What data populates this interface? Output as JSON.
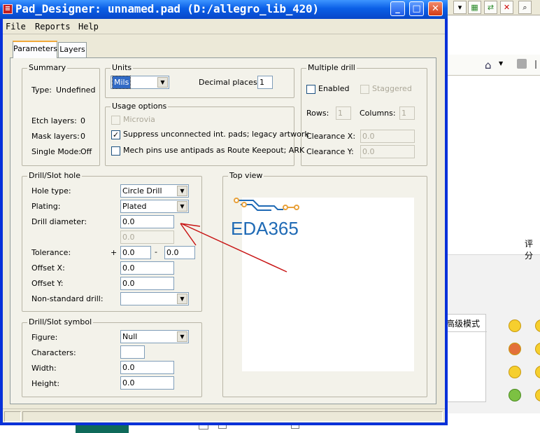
{
  "window": {
    "title": "Pad_Designer: unnamed.pad (D:/allegro_lib_420)",
    "app_icon_glyph": "≡",
    "min_glyph": "_",
    "max_glyph": "□",
    "close_glyph": "✕"
  },
  "menu": {
    "file": "File",
    "reports": "Reports",
    "help": "Help"
  },
  "tabs": [
    {
      "label": "Parameters",
      "active": true
    },
    {
      "label": "Layers",
      "active": false
    }
  ],
  "summary": {
    "legend": "Summary",
    "type_label": "Type:",
    "type_value": "Undefined",
    "etch_label": "Etch layers:",
    "etch_value": "0",
    "mask_label": "Mask layers:",
    "mask_value": "0",
    "single_label": "Single Mode:",
    "single_value": "Off"
  },
  "units": {
    "legend": "Units",
    "unit_value": "Mils",
    "decimal_label": "Decimal places:",
    "decimal_value": "1"
  },
  "multiple_drill": {
    "legend": "Multiple drill",
    "enabled_label": "Enabled",
    "enabled_checked": false,
    "staggered_label": "Staggered",
    "rows_label": "Rows:",
    "rows_value": "1",
    "columns_label": "Columns:",
    "columns_value": "1",
    "clearance_x_label": "Clearance X:",
    "clearance_x_value": "0.0",
    "clearance_y_label": "Clearance Y:",
    "clearance_y_value": "0.0"
  },
  "usage": {
    "legend": "Usage options",
    "microvia_label": "Microvia",
    "suppress_label": "Suppress unconnected int. pads; legacy artwork",
    "suppress_checked": true,
    "mech_label": "Mech pins use antipads as Route Keepout; ARK",
    "mech_checked": false,
    "check_glyph": "✓"
  },
  "drill_hole": {
    "legend": "Drill/Slot hole",
    "hole_type_label": "Hole type:",
    "hole_type_value": "Circle Drill",
    "plating_label": "Plating:",
    "plating_value": "Plated",
    "drill_diameter_label": "Drill diameter:",
    "drill_diameter_value": "0.0",
    "drill_second_value": "0.0",
    "tolerance_label": "Tolerance:",
    "tol_plus": "+",
    "tol_plus_value": "0.0",
    "tol_minus": "-",
    "tol_minus_value": "0.0",
    "offset_x_label": "Offset X:",
    "offset_x_value": "0.0",
    "offset_y_label": "Offset Y:",
    "offset_y_value": "0.0",
    "nonstandard_label": "Non-standard drill:",
    "nonstandard_value": ""
  },
  "drill_symbol": {
    "legend": "Drill/Slot symbol",
    "figure_label": "Figure:",
    "figure_value": "Null",
    "characters_label": "Characters:",
    "characters_value": "",
    "width_label": "Width:",
    "width_value": "0.0",
    "height_label": "Height:",
    "height_value": "0.0"
  },
  "top_view": {
    "legend": "Top view",
    "watermark_text": "EDA365"
  },
  "background_app": {
    "right_label_1": "评分",
    "right_label_2": "高级模式",
    "arrow_glyph": "▾",
    "search_glyph": "⌕"
  },
  "colors": {
    "title_bar": "#0a5fe6",
    "dialog_bg": "#ece9d8",
    "annotation_arrow": "#c81414",
    "logo_blue": "#1f6ab5",
    "logo_orange": "#e8a13a"
  }
}
